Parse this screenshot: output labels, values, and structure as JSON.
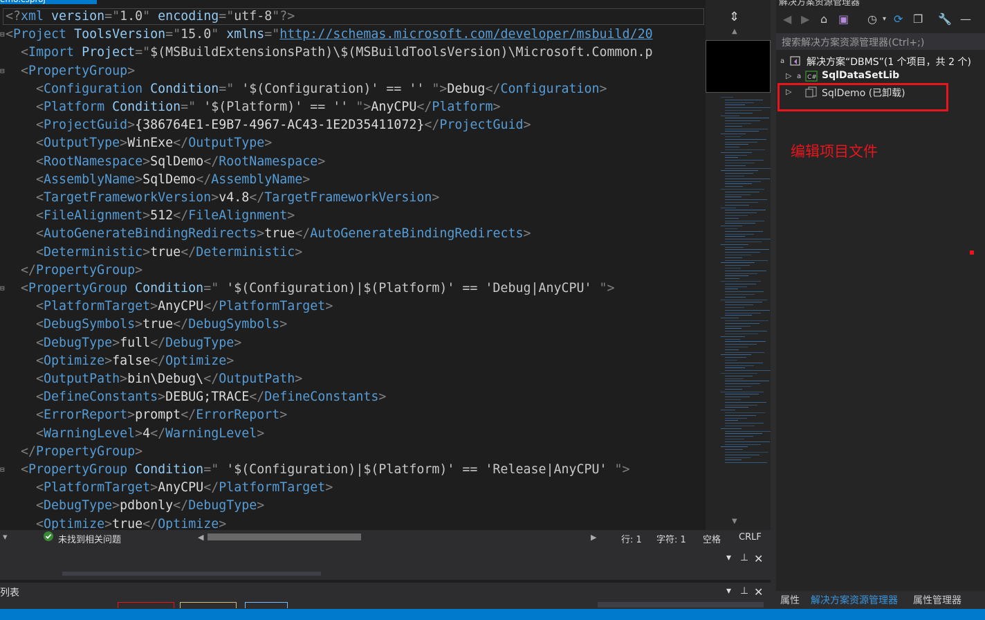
{
  "editor": {
    "tab_title": "emo.csproj",
    "lines": [
      [
        [
          "b",
          "<?"
        ],
        [
          "e",
          "xml"
        ],
        [
          "a",
          " version"
        ],
        [
          "b",
          "=\""
        ],
        [
          "v",
          "1.0"
        ],
        [
          "b",
          "\""
        ],
        [
          "a",
          " encoding"
        ],
        [
          "b",
          "=\""
        ],
        [
          "v",
          "utf-8"
        ],
        [
          "b",
          "\"?>"
        ]
      ],
      [
        [
          "b",
          "<"
        ],
        [
          "e",
          "Project"
        ],
        [
          "a",
          " ToolsVersion"
        ],
        [
          "b",
          "=\""
        ],
        [
          "v",
          "15.0"
        ],
        [
          "b",
          "\""
        ],
        [
          "a",
          " xmlns"
        ],
        [
          "b",
          "=\""
        ],
        [
          "l",
          "http://schemas.microsoft.com/developer/msbuild/20"
        ]
      ],
      [
        [
          "t",
          "  "
        ],
        [
          "b",
          "<"
        ],
        [
          "e",
          "Import"
        ],
        [
          "a",
          " Project"
        ],
        [
          "b",
          "=\""
        ],
        [
          "v",
          "$(MSBuildExtensionsPath)\\$(MSBuildToolsVersion)\\Microsoft.Common.p"
        ]
      ],
      [
        [
          "t",
          "  "
        ],
        [
          "b",
          "<"
        ],
        [
          "e",
          "PropertyGroup"
        ],
        [
          "b",
          ">"
        ]
      ],
      [
        [
          "t",
          "    "
        ],
        [
          "b",
          "<"
        ],
        [
          "e",
          "Configuration"
        ],
        [
          "a",
          " Condition"
        ],
        [
          "b",
          "=\""
        ],
        [
          "v",
          " '$(Configuration)' == '' "
        ],
        [
          "b",
          "\">"
        ],
        [
          "t",
          "Debug"
        ],
        [
          "b",
          "</"
        ],
        [
          "e",
          "Configuration"
        ],
        [
          "b",
          ">"
        ]
      ],
      [
        [
          "t",
          "    "
        ],
        [
          "b",
          "<"
        ],
        [
          "e",
          "Platform"
        ],
        [
          "a",
          " Condition"
        ],
        [
          "b",
          "=\""
        ],
        [
          "v",
          " '$(Platform)' == '' "
        ],
        [
          "b",
          "\">"
        ],
        [
          "t",
          "AnyCPU"
        ],
        [
          "b",
          "</"
        ],
        [
          "e",
          "Platform"
        ],
        [
          "b",
          ">"
        ]
      ],
      [
        [
          "t",
          "    "
        ],
        [
          "b",
          "<"
        ],
        [
          "e",
          "ProjectGuid"
        ],
        [
          "b",
          ">"
        ],
        [
          "t",
          "{386764E1-E9B7-4967-AC43-1E2D35411072}"
        ],
        [
          "b",
          "</"
        ],
        [
          "e",
          "ProjectGuid"
        ],
        [
          "b",
          ">"
        ]
      ],
      [
        [
          "t",
          "    "
        ],
        [
          "b",
          "<"
        ],
        [
          "e",
          "OutputType"
        ],
        [
          "b",
          ">"
        ],
        [
          "t",
          "WinExe"
        ],
        [
          "b",
          "</"
        ],
        [
          "e",
          "OutputType"
        ],
        [
          "b",
          ">"
        ]
      ],
      [
        [
          "t",
          "    "
        ],
        [
          "b",
          "<"
        ],
        [
          "e",
          "RootNamespace"
        ],
        [
          "b",
          ">"
        ],
        [
          "t",
          "SqlDemo"
        ],
        [
          "b",
          "</"
        ],
        [
          "e",
          "RootNamespace"
        ],
        [
          "b",
          ">"
        ]
      ],
      [
        [
          "t",
          "    "
        ],
        [
          "b",
          "<"
        ],
        [
          "e",
          "AssemblyName"
        ],
        [
          "b",
          ">"
        ],
        [
          "t",
          "SqlDemo"
        ],
        [
          "b",
          "</"
        ],
        [
          "e",
          "AssemblyName"
        ],
        [
          "b",
          ">"
        ]
      ],
      [
        [
          "t",
          "    "
        ],
        [
          "b",
          "<"
        ],
        [
          "e",
          "TargetFrameworkVersion"
        ],
        [
          "b",
          ">"
        ],
        [
          "t",
          "v4.8"
        ],
        [
          "b",
          "</"
        ],
        [
          "e",
          "TargetFrameworkVersion"
        ],
        [
          "b",
          ">"
        ]
      ],
      [
        [
          "t",
          "    "
        ],
        [
          "b",
          "<"
        ],
        [
          "e",
          "FileAlignment"
        ],
        [
          "b",
          ">"
        ],
        [
          "t",
          "512"
        ],
        [
          "b",
          "</"
        ],
        [
          "e",
          "FileAlignment"
        ],
        [
          "b",
          ">"
        ]
      ],
      [
        [
          "t",
          "    "
        ],
        [
          "b",
          "<"
        ],
        [
          "e",
          "AutoGenerateBindingRedirects"
        ],
        [
          "b",
          ">"
        ],
        [
          "t",
          "true"
        ],
        [
          "b",
          "</"
        ],
        [
          "e",
          "AutoGenerateBindingRedirects"
        ],
        [
          "b",
          ">"
        ]
      ],
      [
        [
          "t",
          "    "
        ],
        [
          "b",
          "<"
        ],
        [
          "e",
          "Deterministic"
        ],
        [
          "b",
          ">"
        ],
        [
          "t",
          "true"
        ],
        [
          "b",
          "</"
        ],
        [
          "e",
          "Deterministic"
        ],
        [
          "b",
          ">"
        ]
      ],
      [
        [
          "t",
          "  "
        ],
        [
          "b",
          "</"
        ],
        [
          "e",
          "PropertyGroup"
        ],
        [
          "b",
          ">"
        ]
      ],
      [
        [
          "t",
          "  "
        ],
        [
          "b",
          "<"
        ],
        [
          "e",
          "PropertyGroup"
        ],
        [
          "a",
          " Condition"
        ],
        [
          "b",
          "=\""
        ],
        [
          "v",
          " '$(Configuration)|$(Platform)' == 'Debug|AnyCPU' "
        ],
        [
          "b",
          "\">"
        ]
      ],
      [
        [
          "t",
          "    "
        ],
        [
          "b",
          "<"
        ],
        [
          "e",
          "PlatformTarget"
        ],
        [
          "b",
          ">"
        ],
        [
          "t",
          "AnyCPU"
        ],
        [
          "b",
          "</"
        ],
        [
          "e",
          "PlatformTarget"
        ],
        [
          "b",
          ">"
        ]
      ],
      [
        [
          "t",
          "    "
        ],
        [
          "b",
          "<"
        ],
        [
          "e",
          "DebugSymbols"
        ],
        [
          "b",
          ">"
        ],
        [
          "t",
          "true"
        ],
        [
          "b",
          "</"
        ],
        [
          "e",
          "DebugSymbols"
        ],
        [
          "b",
          ">"
        ]
      ],
      [
        [
          "t",
          "    "
        ],
        [
          "b",
          "<"
        ],
        [
          "e",
          "DebugType"
        ],
        [
          "b",
          ">"
        ],
        [
          "t",
          "full"
        ],
        [
          "b",
          "</"
        ],
        [
          "e",
          "DebugType"
        ],
        [
          "b",
          ">"
        ]
      ],
      [
        [
          "t",
          "    "
        ],
        [
          "b",
          "<"
        ],
        [
          "e",
          "Optimize"
        ],
        [
          "b",
          ">"
        ],
        [
          "t",
          "false"
        ],
        [
          "b",
          "</"
        ],
        [
          "e",
          "Optimize"
        ],
        [
          "b",
          ">"
        ]
      ],
      [
        [
          "t",
          "    "
        ],
        [
          "b",
          "<"
        ],
        [
          "e",
          "OutputPath"
        ],
        [
          "b",
          ">"
        ],
        [
          "t",
          "bin\\Debug\\"
        ],
        [
          "b",
          "</"
        ],
        [
          "e",
          "OutputPath"
        ],
        [
          "b",
          ">"
        ]
      ],
      [
        [
          "t",
          "    "
        ],
        [
          "b",
          "<"
        ],
        [
          "e",
          "DefineConstants"
        ],
        [
          "b",
          ">"
        ],
        [
          "t",
          "DEBUG;TRACE"
        ],
        [
          "b",
          "</"
        ],
        [
          "e",
          "DefineConstants"
        ],
        [
          "b",
          ">"
        ]
      ],
      [
        [
          "t",
          "    "
        ],
        [
          "b",
          "<"
        ],
        [
          "e",
          "ErrorReport"
        ],
        [
          "b",
          ">"
        ],
        [
          "t",
          "prompt"
        ],
        [
          "b",
          "</"
        ],
        [
          "e",
          "ErrorReport"
        ],
        [
          "b",
          ">"
        ]
      ],
      [
        [
          "t",
          "    "
        ],
        [
          "b",
          "<"
        ],
        [
          "e",
          "WarningLevel"
        ],
        [
          "b",
          ">"
        ],
        [
          "t",
          "4"
        ],
        [
          "b",
          "</"
        ],
        [
          "e",
          "WarningLevel"
        ],
        [
          "b",
          ">"
        ]
      ],
      [
        [
          "t",
          "  "
        ],
        [
          "b",
          "</"
        ],
        [
          "e",
          "PropertyGroup"
        ],
        [
          "b",
          ">"
        ]
      ],
      [
        [
          "t",
          "  "
        ],
        [
          "b",
          "<"
        ],
        [
          "e",
          "PropertyGroup"
        ],
        [
          "a",
          " Condition"
        ],
        [
          "b",
          "=\""
        ],
        [
          "v",
          " '$(Configuration)|$(Platform)' == 'Release|AnyCPU' "
        ],
        [
          "b",
          "\">"
        ]
      ],
      [
        [
          "t",
          "    "
        ],
        [
          "b",
          "<"
        ],
        [
          "e",
          "PlatformTarget"
        ],
        [
          "b",
          ">"
        ],
        [
          "t",
          "AnyCPU"
        ],
        [
          "b",
          "</"
        ],
        [
          "e",
          "PlatformTarget"
        ],
        [
          "b",
          ">"
        ]
      ],
      [
        [
          "t",
          "    "
        ],
        [
          "b",
          "<"
        ],
        [
          "e",
          "DebugType"
        ],
        [
          "b",
          ">"
        ],
        [
          "t",
          "pdbonly"
        ],
        [
          "b",
          "</"
        ],
        [
          "e",
          "DebugType"
        ],
        [
          "b",
          ">"
        ]
      ],
      [
        [
          "t",
          "    "
        ],
        [
          "b",
          "<"
        ],
        [
          "e",
          "Optimize"
        ],
        [
          "b",
          ">"
        ],
        [
          "t",
          "true"
        ],
        [
          "b",
          "</"
        ],
        [
          "e",
          "Optimize"
        ],
        [
          "b",
          ">"
        ]
      ]
    ]
  },
  "editor_status": {
    "issues": "未找到相关问题",
    "line": "行: 1",
    "char": "字符: 1",
    "spaces": "空格",
    "eol": "CRLF"
  },
  "bottom_panel": {
    "list_label": "列表"
  },
  "solution_explorer": {
    "title": "解决方案资源管理器",
    "search_placeholder": "搜索解决方案资源管理器(Ctrl+;)",
    "tree": [
      {
        "label": "解决方案“DBMS”(1 个项目，共 2 个)",
        "bold": false
      },
      {
        "label": "SqlDataSetLib",
        "bold": true
      },
      {
        "label": "SqlDemo (已卸载)",
        "bold": false
      }
    ],
    "annotation": "编辑项目文件",
    "tabs": [
      "属性",
      "解决方案资源管理器",
      "属性管理器"
    ]
  },
  "colors": {
    "accent": "#007acc",
    "highlight": "#e8161c"
  }
}
